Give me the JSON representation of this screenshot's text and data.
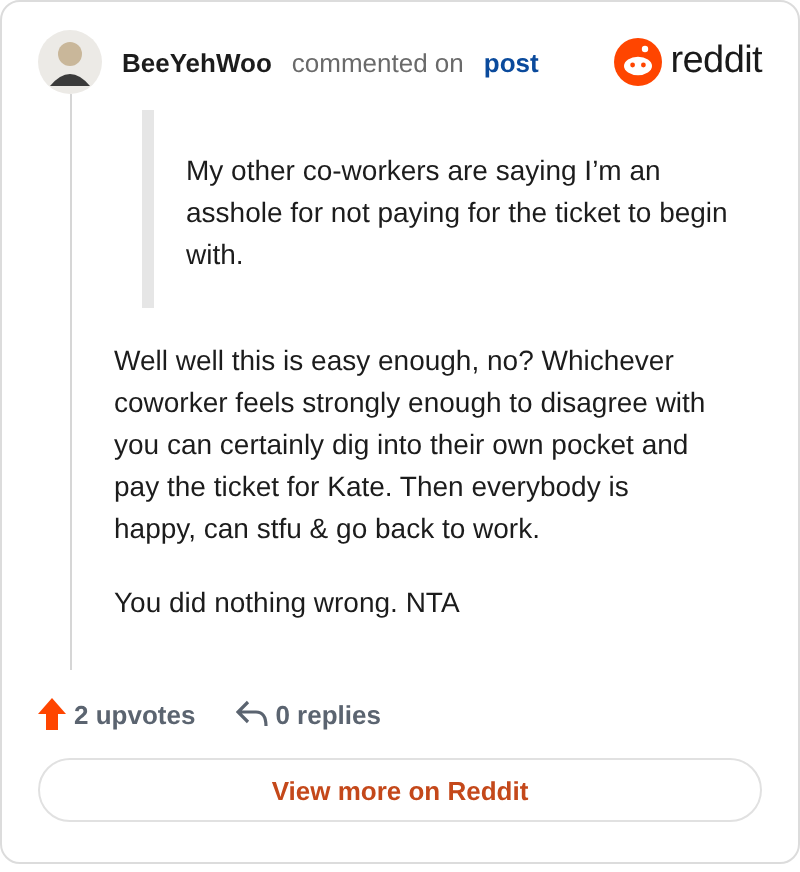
{
  "header": {
    "username": "BeeYehWoo",
    "action": "commented on",
    "link": "post",
    "brand": "reddit"
  },
  "quote": "My other co-workers are saying I’m an asshole for not paying for the ticket to begin with.",
  "paragraphs": [
    "Well well this is easy enough, no? Whichever coworker feels strongly enough to disagree with you can certainly dig into their own pocket and pay the ticket for Kate. Then everybody is happy, can stfu & go back to work.",
    "You did nothing wrong. NTA"
  ],
  "stats": {
    "upvotes": "2 upvotes",
    "replies": "0 replies"
  },
  "button": "View more on Reddit"
}
